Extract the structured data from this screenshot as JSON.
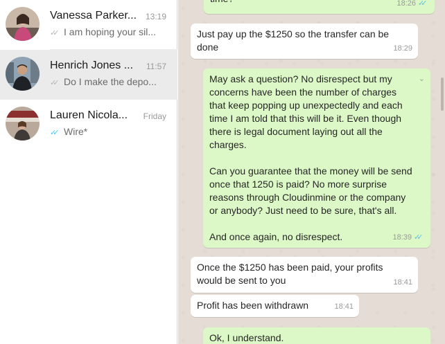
{
  "colors": {
    "read_tick": "#4fc3f7",
    "sent_tick": "#b3b3b3",
    "outgoing_bubble": "#dcf8c6",
    "incoming_bubble": "#ffffff",
    "chat_background": "#e5ddd5",
    "active_chat": "#ebebeb"
  },
  "chats": [
    {
      "name": "Vanessa Parker...",
      "time": "13:19",
      "preview": "I am hoping your sil...",
      "tick": "✓✓",
      "tick_status": "sent"
    },
    {
      "name": "Henrich Jones ...",
      "time": "11:57",
      "preview": "Do I make the depo...",
      "tick": "✓✓",
      "tick_status": "sent",
      "active": true
    },
    {
      "name": "Lauren Nicola...",
      "time": "Friday",
      "preview": "Wire*",
      "tick": "✓✓",
      "tick_status": "read"
    }
  ],
  "messages": [
    {
      "direction": "out",
      "text": "time?",
      "time": "18:26",
      "tick": "✓✓"
    },
    {
      "direction": "in",
      "text": "Just pay up the $1250 so the transfer can be\ndone",
      "time": "18:29"
    },
    {
      "direction": "out",
      "text": "May ask a question? No disrespect but my\nconcerns have been the number of charges\nthat keep popping up unexpectedly and each\ntime I am told that this will be it. Even though\nthere is legal document laying out all the\ncharges.\n\nCan you guarantee that the money will be send\nonce that 1250 is paid? No more surprise\nreasons through Cloudinmine or the company\nor anybody? Just need to be sure, that's all.\n\nAnd once again, no disrespect.",
      "time": "18:39",
      "tick": "✓✓"
    },
    {
      "direction": "in",
      "text": "Once the $1250 has been paid, your profits\nwould be sent to you",
      "time": "18:41"
    },
    {
      "direction": "in",
      "text": "Profit has been withdrawn",
      "time": "18:41"
    },
    {
      "direction": "out",
      "text": "Ok, I understand.",
      "time": ""
    }
  ]
}
